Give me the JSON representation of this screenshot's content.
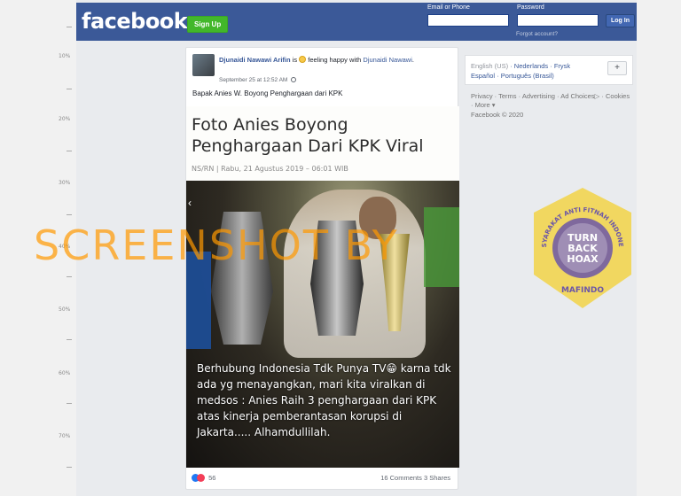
{
  "ruler": {
    "marks": [
      "10%",
      "20%",
      "30%",
      "40%",
      "50%",
      "60%",
      "70%"
    ]
  },
  "header": {
    "logo": "facebook",
    "signup_label": "Sign Up",
    "email_label": "Email or Phone",
    "password_label": "Password",
    "forgot_label": "Forgot account?",
    "login_label": "Log In"
  },
  "post": {
    "author": "Djunaidi Nawawi Arifin",
    "status_prefix": "is",
    "status_text": "feeling happy with",
    "tagged": "Djunaidi Nawawi",
    "tagged_suffix": ".",
    "timestamp": "September 25 at 12:52 AM",
    "text": "Bapak Anies W. Boyong Penghargaan dari KPK",
    "news_title": "Foto Anies Boyong Penghargaan Dari KPK Viral",
    "news_meta": "NS/RN | Rabu, 21 Agustus 2019 – 06:01 WIB",
    "photo_caption": "Berhubung Indonesia Tdk Punya TV😁 karna tdk ada yg menayangkan, mari kita viralkan di medsos : Anies Raih 3 penghargaan dari KPK atas kinerja pemberantasan korupsi di Jakarta..... Alhamdullilah.",
    "reaction_count": "56",
    "comments": "16 Comments",
    "shares": "3 Shares"
  },
  "sidebar": {
    "lang_current": "English (US)",
    "lang_options_line1": [
      "Nederlands",
      "Frysk"
    ],
    "lang_options_line2": [
      "Español",
      "Português (Brasil)"
    ],
    "plus_label": "+",
    "footer_links": [
      "Privacy",
      "Terms",
      "Advertising",
      "Ad Choices",
      "Cookies",
      "More"
    ],
    "copyright": "Facebook © 2020"
  },
  "overlay": {
    "watermark": "SCREENSHOT BY",
    "badge_top": "MASYARAKAT ANTI FITNAH INDONESIA",
    "badge_center_1": "TURN",
    "badge_center_2": "BACK",
    "badge_center_3": "HOAX",
    "badge_bottom": "MAFINDO"
  },
  "colors": {
    "fb_blue": "#3b5998",
    "signup_green": "#42b72a",
    "link_blue": "#385898",
    "watermark_orange": "#ff9900",
    "badge_yellow": "#f2d23c",
    "badge_purple": "#6b56a8"
  }
}
